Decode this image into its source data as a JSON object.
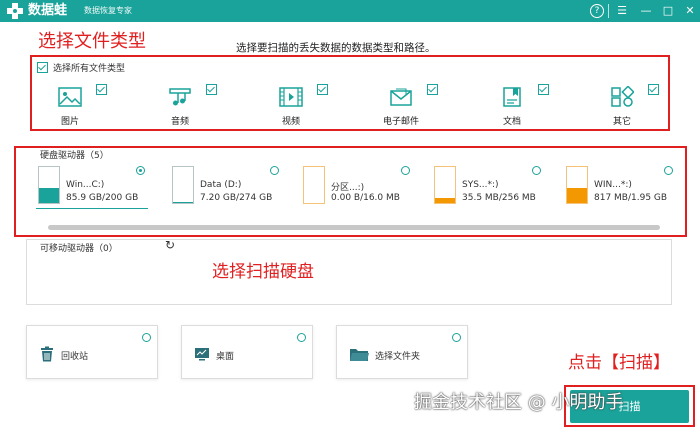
{
  "titlebar": {
    "app_name": "数据蛙",
    "subtitle": "数据恢复专家",
    "help": "?",
    "menu": "☰",
    "minimize": "—",
    "maximize": "□",
    "close": "✕",
    "bg_color": "#1aa39a"
  },
  "annotations": {
    "choose_file_type": "选择文件类型",
    "choose_disk": "选择扫描硬盘",
    "click_scan": "点击【扫描】",
    "color": "#e02020"
  },
  "instruction": "选择要扫描的丢失数据的数据类型和路径。",
  "file_types": {
    "select_all": "选择所有文件类型",
    "select_all_checked": true,
    "items": [
      {
        "label": "图片",
        "icon": "image-icon",
        "checked": true
      },
      {
        "label": "音频",
        "icon": "music-icon",
        "checked": true
      },
      {
        "label": "视频",
        "icon": "video-icon",
        "checked": true
      },
      {
        "label": "电子邮件",
        "icon": "email-icon",
        "checked": true
      },
      {
        "label": "文档",
        "icon": "document-icon",
        "checked": true
      },
      {
        "label": "其它",
        "icon": "other-icon",
        "checked": true
      }
    ]
  },
  "drives": {
    "title": "硬盘驱动器（5）",
    "items": [
      {
        "name": "Win...C:)",
        "size": "85.9 GB/200 GB",
        "selected": true,
        "fill": 0.43,
        "color": "#1aa39a"
      },
      {
        "name": "Data (D:)",
        "size": "7.20 GB/274 GB",
        "selected": false,
        "fill": 0.03,
        "color": "#1aa39a"
      },
      {
        "name": "分区...:)",
        "size": "0.00  B/16.0 MB",
        "selected": false,
        "fill": 0.0,
        "color": "#f39800"
      },
      {
        "name": "SYS...*:)",
        "size": "35.5 MB/256 MB",
        "selected": false,
        "fill": 0.14,
        "color": "#f39800"
      },
      {
        "name": "WIN...*:)",
        "size": "817 MB/1.95 GB",
        "selected": false,
        "fill": 0.42,
        "color": "#f39800"
      }
    ]
  },
  "removable": {
    "title": "可移动驱动器（0）",
    "refresh_icon": "↻"
  },
  "locations": [
    {
      "label": "回收站",
      "icon": "recycle-bin-icon"
    },
    {
      "label": "桌面",
      "icon": "desktop-icon"
    },
    {
      "label": "选择文件夹",
      "icon": "folder-icon"
    }
  ],
  "scan_button": "扫描",
  "watermark": "掘金技术社区 @ 小明助手"
}
